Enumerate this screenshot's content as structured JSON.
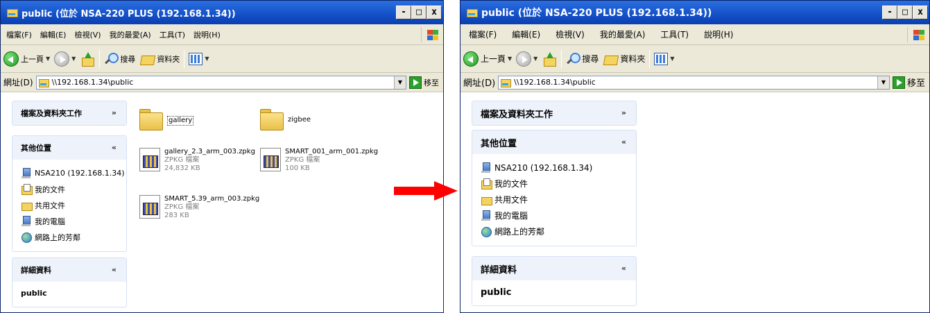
{
  "left_window": {
    "title": "public (位於 NSA-220 PLUS (192.168.1.34))",
    "controls": [
      "-",
      "□",
      "x"
    ],
    "menu": [
      "檔案(F)",
      "編輯(E)",
      "檢視(V)",
      "我的最愛(A)",
      "工具(T)",
      "說明(H)"
    ],
    "toolbar": {
      "back": "上一頁",
      "search": "搜尋",
      "folders": "資料夾"
    },
    "address": {
      "label": "網址(D)",
      "value": "\\\\192.168.1.34\\public",
      "go": "移至"
    },
    "tasks_panel": {
      "title": "檔案及資料夾工作"
    },
    "other_places": {
      "title": "其他位置",
      "items": [
        {
          "label": "NSA210 (192.168.1.34)",
          "icon": "network-computer-icon"
        },
        {
          "label": "我的文件",
          "icon": "my-documents-icon"
        },
        {
          "label": "共用文件",
          "icon": "shared-documents-icon"
        },
        {
          "label": "我的電腦",
          "icon": "my-computer-icon"
        },
        {
          "label": "網路上的芳鄰",
          "icon": "network-places-icon"
        }
      ]
    },
    "details": {
      "title": "詳細資料",
      "name": "public"
    },
    "files": [
      {
        "name": "gallery",
        "type": "folder"
      },
      {
        "name": "zigbee",
        "type": "folder"
      },
      {
        "name": "gallery_2.3_arm_003.zpkg",
        "kind": "ZPKG 檔案",
        "size": "24,832 KB"
      },
      {
        "name": "SMART_001_arm_001.zpkg",
        "kind": "ZPKG 檔案",
        "size": "100 KB"
      },
      {
        "name": "SMART_5.39_arm_003.zpkg",
        "kind": "ZPKG 檔案",
        "size": "283 KB"
      }
    ]
  },
  "right_window": {
    "title": "public (位於 NSA-220 PLUS (192.168.1.34))",
    "controls": [
      "-",
      "□",
      "x"
    ],
    "menu": [
      "檔案(F)",
      "編輯(E)",
      "檢視(V)",
      "我的最愛(A)",
      "工具(T)",
      "說明(H)"
    ],
    "toolbar": {
      "back": "上一頁",
      "search": "搜尋",
      "folders": "資料夾"
    },
    "address": {
      "label": "網址(D)",
      "value": "\\\\192.168.1.34\\public",
      "go": "移至"
    },
    "tasks_panel": {
      "title": "檔案及資料夾工作"
    },
    "other_places": {
      "title": "其他位置",
      "items": [
        {
          "label": "NSA210 (192.168.1.34)",
          "icon": "network-computer-icon"
        },
        {
          "label": "我的文件",
          "icon": "my-documents-icon"
        },
        {
          "label": "共用文件",
          "icon": "shared-documents-icon"
        },
        {
          "label": "我的電腦",
          "icon": "my-computer-icon"
        },
        {
          "label": "網路上的芳鄰",
          "icon": "network-places-icon"
        }
      ]
    },
    "details": {
      "title": "詳細資料",
      "name": "public"
    }
  },
  "colors": {
    "titlebar": "#1450c8",
    "arrow": "#ff0000",
    "chrome": "#ece9d8"
  }
}
